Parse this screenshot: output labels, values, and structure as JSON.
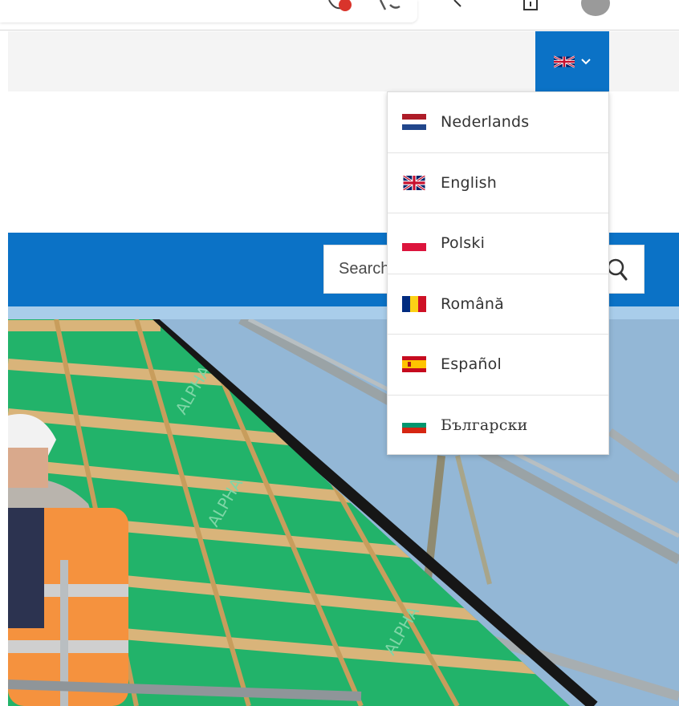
{
  "colors": {
    "brand_blue": "#0b72c6",
    "light_blue": "#a9cdea",
    "topbar_gray": "#f4f4f4",
    "roof_green": "#22b36a",
    "batten_wood": "#d9b47a",
    "sky": "#93b7d6",
    "vest_orange": "#f5923e"
  },
  "language_selector": {
    "current_flag": "uk-flag-icon",
    "toggle_icon": "chevron-down-icon"
  },
  "languages": [
    {
      "label": "Nederlands",
      "flag": "netherlands-flag-icon"
    },
    {
      "label": "English",
      "flag": "uk-flag-icon"
    },
    {
      "label": "Polski",
      "flag": "poland-flag-icon"
    },
    {
      "label": "Română",
      "flag": "romania-flag-icon"
    },
    {
      "label": "Español",
      "flag": "spain-flag-icon"
    },
    {
      "label": "Български",
      "flag": "bulgaria-flag-icon"
    }
  ],
  "search": {
    "placeholder": "Search",
    "icon": "search-icon"
  }
}
